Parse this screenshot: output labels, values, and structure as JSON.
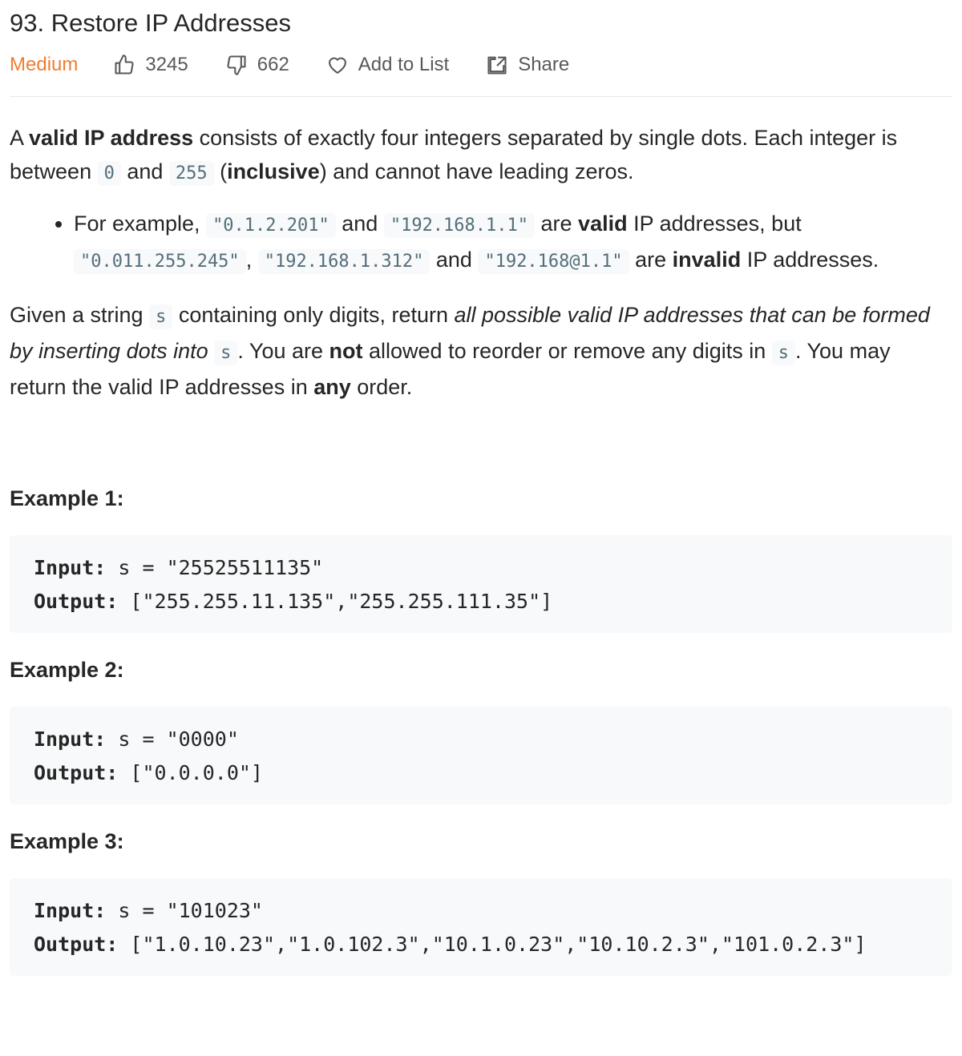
{
  "problem": {
    "title": "93. Restore IP Addresses",
    "difficulty": "Medium",
    "likes": "3245",
    "dislikes": "662",
    "add_to_list": "Add to List",
    "share": "Share"
  },
  "description": {
    "p1_a": "A ",
    "p1_b": "valid IP address",
    "p1_c": " consists of exactly four integers separated by single dots. Each integer is between ",
    "p1_d": "0",
    "p1_e": " and ",
    "p1_f": "255",
    "p1_g": " (",
    "p1_h": "inclusive",
    "p1_i": ") and cannot have leading zeros.",
    "li_a": "For example, ",
    "li_b": "\"0.1.2.201\"",
    "li_c": " and ",
    "li_d": "\"192.168.1.1\"",
    "li_e": " are ",
    "li_f": "valid",
    "li_g": " IP addresses, but ",
    "li_h": "\"0.011.255.245\"",
    "li_i": ", ",
    "li_j": "\"192.168.1.312\"",
    "li_k": " and ",
    "li_l": "\"192.168@1.1\"",
    "li_m": " are ",
    "li_n": "invalid",
    "li_o": " IP addresses.",
    "p2_a": "Given a string ",
    "p2_b": "s",
    "p2_c": " containing only digits, return ",
    "p2_d": "all possible valid IP addresses that can be formed by inserting dots into",
    "p2_e": " ",
    "p2_f": "s",
    "p2_g": ". You are ",
    "p2_h": "not",
    "p2_i": " allowed to reorder or remove any digits in ",
    "p2_j": "s",
    "p2_k": ". You may return the valid IP addresses in ",
    "p2_l": "any",
    "p2_m": " order."
  },
  "examples": [
    {
      "heading": "Example 1:",
      "input_label": "Input:",
      "input": " s = \"25525511135\"",
      "output_label": "Output:",
      "output": " [\"255.255.11.135\",\"255.255.111.35\"]"
    },
    {
      "heading": "Example 2:",
      "input_label": "Input:",
      "input": " s = \"0000\"",
      "output_label": "Output:",
      "output": " [\"0.0.0.0\"]"
    },
    {
      "heading": "Example 3:",
      "input_label": "Input:",
      "input": " s = \"101023\"",
      "output_label": "Output:",
      "output": " [\"1.0.10.23\",\"1.0.102.3\",\"10.1.0.23\",\"10.10.2.3\",\"101.0.2.3\"]"
    }
  ],
  "colors": {
    "difficulty": "#ef7d31",
    "code_bg": "#f7f9fa",
    "code_text": "#546e7a"
  },
  "icons": [
    "thumbs-up-icon",
    "thumbs-down-icon",
    "heart-icon",
    "share-icon"
  ]
}
